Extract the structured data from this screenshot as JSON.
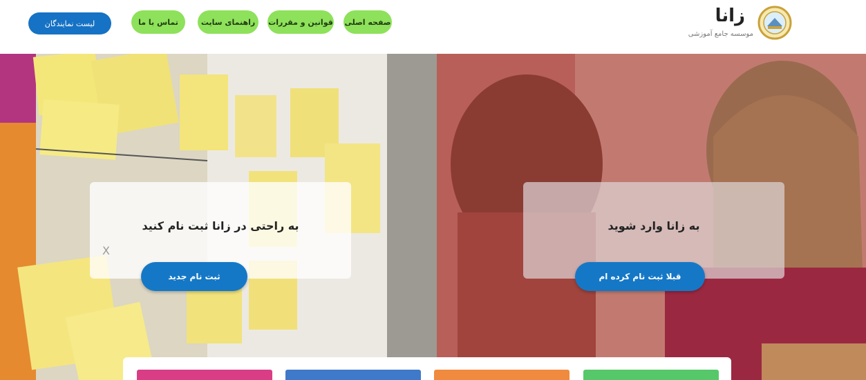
{
  "header": {
    "brand_name": "زانا",
    "brand_subtitle": "موسسه جامع آموزشی",
    "nav": [
      {
        "label": "صفحه اصلی"
      },
      {
        "label": "قوانین و مقررات"
      },
      {
        "label": "راهنمای سایت"
      },
      {
        "label": "تماس با ما"
      }
    ],
    "agents_label": "لیست نمایندگان"
  },
  "hero": {
    "register": {
      "title": "به راحتی در زانا ثبت نام کنید",
      "close_glyph": "X",
      "button": "ثبت نام جدید"
    },
    "login": {
      "title": "به زانا وارد شوید",
      "button": "قبلا ثبت نام کرده ام"
    }
  },
  "colors": {
    "nav_green": "#8ee15a",
    "primary_blue": "#1672c4",
    "tile_pink": "#d93d86",
    "tile_blue": "#3f79c9",
    "tile_orange": "#f08a3e",
    "tile_green": "#56c86a"
  },
  "tiles": [
    {
      "color": "tile_pink"
    },
    {
      "color": "tile_blue"
    },
    {
      "color": "tile_orange"
    },
    {
      "color": "tile_green"
    }
  ]
}
